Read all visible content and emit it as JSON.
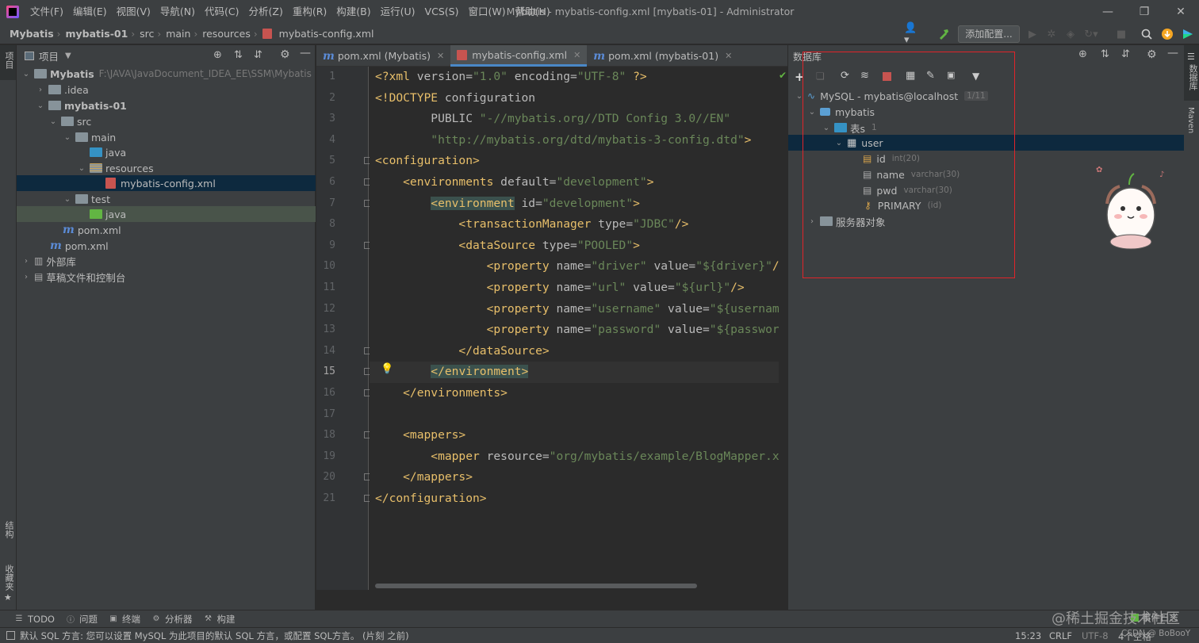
{
  "menu": [
    "文件(F)",
    "编辑(E)",
    "视图(V)",
    "导航(N)",
    "代码(C)",
    "分析(Z)",
    "重构(R)",
    "构建(B)",
    "运行(U)",
    "VCS(S)",
    "窗口(W)",
    "帮助(H)"
  ],
  "window_title": "Mybatis - mybatis-config.xml [mybatis-01] - Administrator",
  "breadcrumbs": [
    "Mybatis",
    "mybatis-01",
    "src",
    "main",
    "resources",
    "mybatis-config.xml"
  ],
  "toolbar": {
    "add_config": "添加配置..."
  },
  "left_stripe": {
    "project": "项目",
    "structure": "结构",
    "favorites": "收藏夹"
  },
  "right_stripe": {
    "database": "数据库",
    "maven": "Maven"
  },
  "project_panel": {
    "title": "项目",
    "tree": [
      {
        "label": "Mybatis",
        "path": "F:\\JAVA\\JavaDocument_IDEA_EE\\SSM\\Mybatis"
      },
      {
        "label": ".idea"
      },
      {
        "label": "mybatis-01"
      },
      {
        "label": "src"
      },
      {
        "label": "main"
      },
      {
        "label": "java"
      },
      {
        "label": "resources"
      },
      {
        "label": "mybatis-config.xml"
      },
      {
        "label": "test"
      },
      {
        "label": "java"
      },
      {
        "label": "pom.xml"
      },
      {
        "label": "pom.xml"
      },
      {
        "label": "外部库"
      },
      {
        "label": "草稿文件和控制台"
      }
    ]
  },
  "editor": {
    "tabs": [
      {
        "label": "pom.xml (Mybatis)"
      },
      {
        "label": "mybatis-config.xml"
      },
      {
        "label": "pom.xml (mybatis-01)"
      }
    ],
    "line_numbers": [
      "1",
      "2",
      "3",
      "4",
      "5",
      "6",
      "7",
      "8",
      "9",
      "10",
      "11",
      "12",
      "13",
      "14",
      "15",
      "16",
      "17",
      "18",
      "19",
      "20",
      "21"
    ],
    "lines": [
      [
        [
          "t",
          "<?xml "
        ],
        [
          "a",
          "version="
        ],
        [
          "v",
          "\"1.0\""
        ],
        [
          "a",
          " encoding="
        ],
        [
          "v",
          "\"UTF-8\""
        ],
        [
          "t",
          " ?>"
        ]
      ],
      [
        [
          "t",
          "<!DOCTYPE "
        ],
        [
          "a",
          "configuration"
        ]
      ],
      [
        [
          "a",
          "        PUBLIC "
        ],
        [
          "v",
          "\"-//mybatis.org//DTD Config 3.0//EN\""
        ]
      ],
      [
        [
          "v",
          "        \"http://mybatis.org/dtd/mybatis-3-config.dtd\""
        ],
        [
          "t",
          ">"
        ]
      ],
      [
        [
          "t",
          "<configuration>"
        ]
      ],
      [
        [
          "t",
          "    <environments "
        ],
        [
          "a",
          "default="
        ],
        [
          "v",
          "\"development\""
        ],
        [
          "t",
          ">"
        ]
      ],
      [
        [
          "t",
          "        "
        ],
        [
          "h",
          "<environment"
        ],
        [
          "a",
          " id="
        ],
        [
          "v",
          "\"development\""
        ],
        [
          "t",
          ">"
        ]
      ],
      [
        [
          "t",
          "            <transactionManager "
        ],
        [
          "a",
          "type="
        ],
        [
          "v",
          "\"JDBC\""
        ],
        [
          "t",
          "/>"
        ]
      ],
      [
        [
          "t",
          "            <dataSource "
        ],
        [
          "a",
          "type="
        ],
        [
          "v",
          "\"POOLED\""
        ],
        [
          "t",
          ">"
        ]
      ],
      [
        [
          "t",
          "                <property "
        ],
        [
          "a",
          "name="
        ],
        [
          "v",
          "\"driver\""
        ],
        [
          "a",
          " value="
        ],
        [
          "v",
          "\"${driver}\""
        ],
        [
          "t",
          "/>"
        ]
      ],
      [
        [
          "t",
          "                <property "
        ],
        [
          "a",
          "name="
        ],
        [
          "v",
          "\"url\""
        ],
        [
          "a",
          " value="
        ],
        [
          "v",
          "\"${url}\""
        ],
        [
          "t",
          "/>"
        ]
      ],
      [
        [
          "t",
          "                <property "
        ],
        [
          "a",
          "name="
        ],
        [
          "v",
          "\"username\""
        ],
        [
          "a",
          " value="
        ],
        [
          "v",
          "\"${username}\""
        ],
        [
          "t",
          "/>"
        ]
      ],
      [
        [
          "t",
          "                <property "
        ],
        [
          "a",
          "name="
        ],
        [
          "v",
          "\"password\""
        ],
        [
          "a",
          " value="
        ],
        [
          "v",
          "\"${password}\""
        ],
        [
          "t",
          "/>"
        ]
      ],
      [
        [
          "t",
          "            </dataSource>"
        ]
      ],
      [
        [
          "t",
          "        "
        ],
        [
          "h",
          "</environment>"
        ]
      ],
      [
        [
          "t",
          "    </environments>"
        ]
      ],
      [
        [
          "t",
          ""
        ]
      ],
      [
        [
          "t",
          "    <mappers>"
        ]
      ],
      [
        [
          "t",
          "        <mapper "
        ],
        [
          "a",
          "resource="
        ],
        [
          "v",
          "\"org/mybatis/example/BlogMapper.xml\""
        ],
        [
          "t",
          "/>"
        ]
      ],
      [
        [
          "t",
          "    </mappers>"
        ]
      ],
      [
        [
          "t",
          "</configuration>"
        ]
      ]
    ]
  },
  "database_panel": {
    "title": "数据库",
    "tree": [
      {
        "label": "MySQL - mybatis@localhost",
        "extra": "1/11"
      },
      {
        "label": "mybatis"
      },
      {
        "label": "表s",
        "extra": "1"
      },
      {
        "label": "user"
      },
      {
        "label": "id",
        "extra": "int(20)"
      },
      {
        "label": "name",
        "extra": "varchar(30)"
      },
      {
        "label": "pwd",
        "extra": "varchar(30)"
      },
      {
        "label": "PRIMARY",
        "extra": "(id)"
      },
      {
        "label": "服务器对象"
      }
    ]
  },
  "bottom_tools": [
    "TODO",
    "问题",
    "终端",
    "分析器",
    "构建"
  ],
  "status": {
    "message": "默认 SQL 方言: 您可以设置 MySQL 为此项目的默认 SQL 方言，或配置 SQL方言。 (片刻 之前)",
    "position": "15:23",
    "line_sep": "CRLF",
    "encoding": "UTF-8",
    "indent": "4个空格",
    "event_log": "事件日志"
  },
  "watermark": "@稀土掘金技术社区",
  "watermark2": "CSDN @ BoBooY",
  "colors": {
    "selection": "#0d293e",
    "redbox": "#e0242a",
    "accent": "#4a88c7"
  }
}
